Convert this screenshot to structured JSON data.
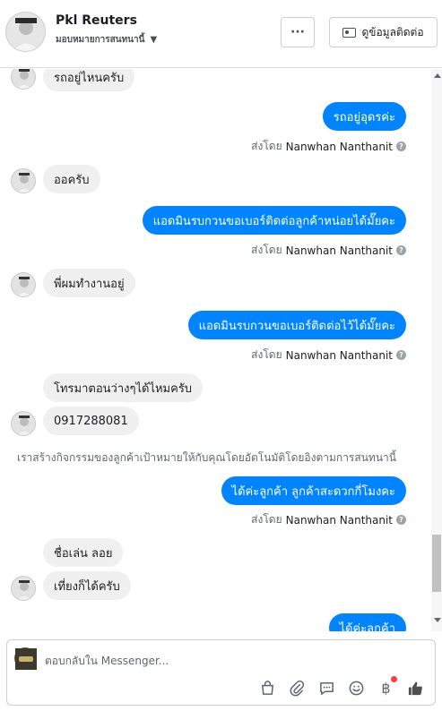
{
  "header": {
    "name": "Pkl Reuters",
    "subtitle": "มอบหมายการสนทนานี้",
    "more_label": "···",
    "contact_label": "ดูข้อมูลติดต่อ"
  },
  "messages": {
    "m1": "รถอยู่ไหนครับ",
    "m2": "รถอยู่อุดรค่ะ",
    "m3": "ออครับ",
    "m4": "แอดมินรบกวนขอเบอร์ติดต่อลูกค้าหน่อยได้มั๊ยคะ",
    "m5": "พี่ผมทำงานอยู่",
    "m6": "แอดมินรบกวนขอเบอร์ติดต่อไว้ได้มั๊ยคะ",
    "m7": "โทรมาตอนว่างๆได้ไหมครับ",
    "m8": "0917288081",
    "m9": "ได้ค่ะลูกค้า ลูกค้าสะดวกกี่โมงคะ",
    "m10": "ชื่อเล่น ลอย",
    "m11": "เที่ยงก็ได้ครับ",
    "m12": "ได้ค่ะลูกค้า"
  },
  "sent_by": {
    "prefix": "ส่งโดย",
    "sender": "Nanwhan Nanthanit",
    "help": "?"
  },
  "notice": "เราสร้างกิจกรรมของลูกค้าเป้าหมายให้กับคุณโดยอัตโนมัติโดยอิงตามการสนทนานี้",
  "composer": {
    "placeholder": "ตอบกลับใน Messenger..."
  },
  "icons": {
    "tools": [
      "shopping-bag-icon",
      "paperclip-icon",
      "saved-reply-icon",
      "emoji-icon",
      "baht-icon",
      "thumbs-up-icon"
    ]
  },
  "colors": {
    "outgoing": "#0084ff",
    "incoming": "#f1f0f0",
    "notification": "#fa3e3e"
  }
}
